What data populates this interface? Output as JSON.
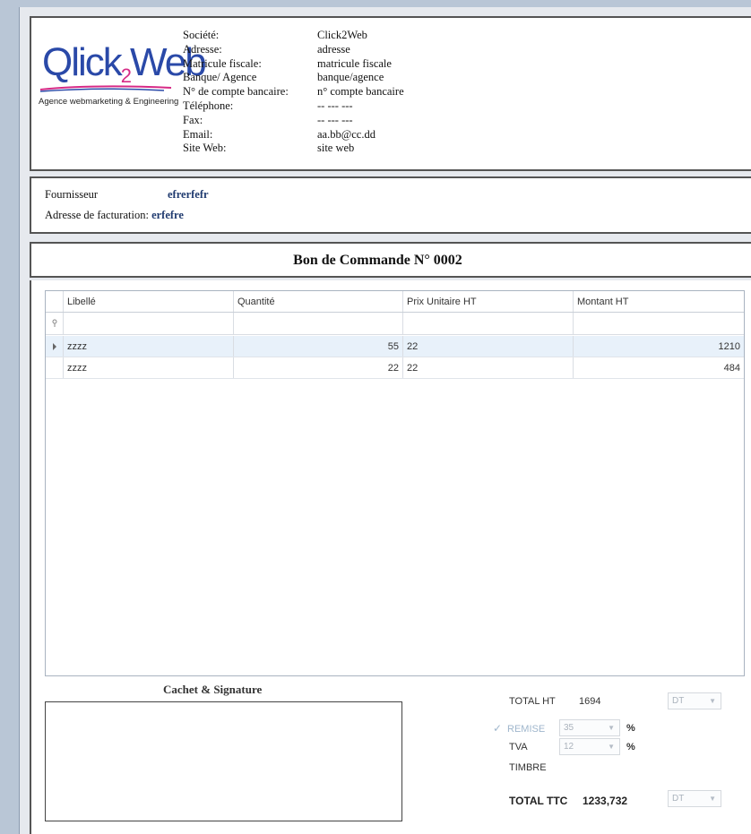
{
  "company": {
    "logo": {
      "part1": "Qlick",
      "part2": "2",
      "part3": "Web",
      "tagline": "Agence webmarketing & Engineering"
    },
    "fields": [
      {
        "label": "Société:",
        "value": "Click2Web"
      },
      {
        "label": "Adresse:",
        "value": "adresse"
      },
      {
        "label": "Matricule fiscale:",
        "value": "matricule fiscale"
      },
      {
        "label": "Banque/ Agence",
        "value": "banque/agence"
      },
      {
        "label": "N° de compte bancaire:",
        "value": "n° compte bancaire"
      },
      {
        "label": "Téléphone:",
        "value": "-- --- ---"
      },
      {
        "label": "Fax:",
        "value": "-- --- ---"
      },
      {
        "label": "Email:",
        "value": "aa.bb@cc.dd"
      },
      {
        "label": "Site Web:",
        "value": "site web"
      }
    ]
  },
  "supplier": {
    "label": "Fournisseur",
    "value": "efrerfefr",
    "billing_label": "Adresse de facturation:",
    "billing_value": "erfefre"
  },
  "document": {
    "title": "Bon de Commande N° 0002"
  },
  "grid": {
    "columns": [
      "Libellé",
      "Quantité",
      "Prix Unitaire HT",
      "Montant HT"
    ],
    "filter_icon": "pin-icon",
    "rows": [
      {
        "libelle": "zzzz",
        "quantite": "55",
        "prix": "22",
        "montant": "1210",
        "selected": true
      },
      {
        "libelle": "zzzz",
        "quantite": "22",
        "prix": "22",
        "montant": "484",
        "selected": false
      }
    ]
  },
  "signature": {
    "label": "Cachet & Signature"
  },
  "totals": {
    "total_ht_label": "TOTAL HT",
    "total_ht_value": "1694",
    "currency": "DT",
    "remise_label": "REMISE",
    "remise_value": "35",
    "remise_checked": true,
    "tva_label": "TVA",
    "tva_value": "12",
    "percent": "%",
    "timbre_label": "TIMBRE",
    "total_ttc_label": "TOTAL TTC",
    "total_ttc_value": "1233,732",
    "currency_ttc": "DT"
  },
  "colors": {
    "logo_blue": "#2a49a8",
    "logo_pink": "#d62a86",
    "supplier_value": "#1f3a6f",
    "selected_row": "#e8f1fa"
  }
}
